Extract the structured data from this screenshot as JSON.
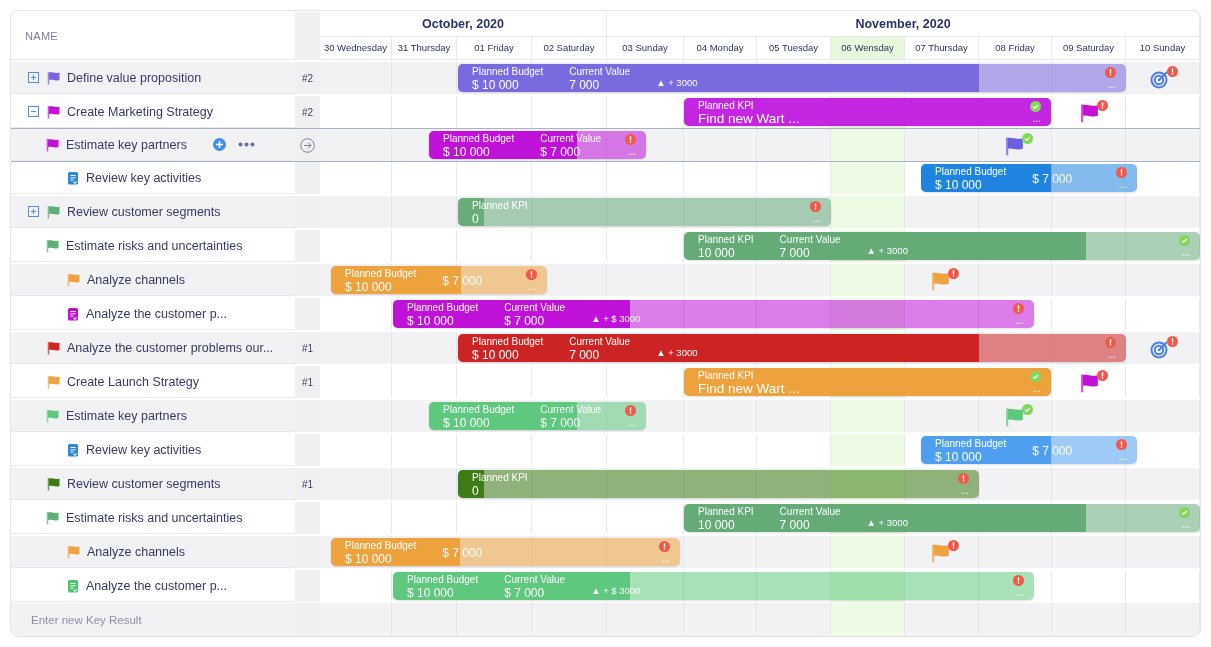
{
  "name_header": "NAME",
  "months": [
    {
      "label": "October, 2020"
    },
    {
      "label": "November, 2020"
    }
  ],
  "days": [
    {
      "label": "30 Wednesday",
      "selected": false
    },
    {
      "label": "31 Thursday",
      "selected": false
    },
    {
      "label": "01 Friday",
      "selected": false
    },
    {
      "label": "02 Saturday",
      "selected": false
    },
    {
      "label": "03 Sunday",
      "selected": false
    },
    {
      "label": "04 Monday",
      "selected": false
    },
    {
      "label": "05 Tuesday",
      "selected": false
    },
    {
      "label": "06 Wensday",
      "selected": true
    },
    {
      "label": "07 Thursday",
      "selected": false
    },
    {
      "label": "08 Friday",
      "selected": false
    },
    {
      "label": "09 Saturday",
      "selected": false
    },
    {
      "label": "10 Sunday",
      "selected": false
    }
  ],
  "rows": [
    {
      "title": "Define value proposition",
      "kind": "flag",
      "color": "#7a63e3",
      "expanded": false,
      "rank": "#2",
      "selected": false,
      "bar": {
        "color": "#7a6ae0",
        "level": 0.78,
        "fields": [
          {
            "label": "Planned Budget",
            "value": "$ 10 000"
          },
          {
            "label": "Current Value",
            "value": "7 000"
          }
        ],
        "delta": "▲ + 3000",
        "alert": true,
        "more": "..."
      },
      "marker": {
        "kind": "target",
        "alert": true
      }
    },
    {
      "title": "Create Marketing Strategy",
      "kind": "flag",
      "color": "#c30fd6",
      "expanded": true,
      "rank": "#2",
      "selected": false,
      "bar": {
        "color": "#c425e0",
        "level": 1,
        "fields": [
          {
            "label": "Planned KPI",
            "value": "Find new Wart ...",
            "large": true
          }
        ],
        "alert": false,
        "more": "..."
      },
      "marker": {
        "kind": "flag",
        "color": "#c30fd6",
        "alert": true
      },
      "children": [
        {
          "title": "Estimate key partners",
          "kind": "flag",
          "color": "#c30fd6",
          "selected": true,
          "bar": {
            "color": "#c011d8",
            "level": 0.68,
            "fields": [
              {
                "label": "Planned Budget",
                "value": "$ 10 000"
              },
              {
                "label": "Current Value",
                "value": "$ 7 000"
              }
            ],
            "alert": true,
            "more": "..."
          },
          "marker": {
            "kind": "flag",
            "color": "#6d5fe0",
            "alert": false
          },
          "children": [
            {
              "title": "Review key activities",
              "kind": "doc",
              "color": "#2f86e0",
              "selected": false,
              "bar": {
                "color": "#1e84e0",
                "level": 0.6,
                "fields": [
                  {
                    "label": "Planned Budget",
                    "value": "$ 10 000"
                  },
                  {
                    "value": "$ 7 000"
                  }
                ],
                "alert": true,
                "more": "..."
              }
            }
          ]
        }
      ]
    },
    {
      "title": "Review customer segments",
      "kind": "flag",
      "color": "#5fae78",
      "expanded": false,
      "selected": false,
      "bar": {
        "color": "#66ad7a",
        "level": 0.07,
        "fields": [
          {
            "label": "Planned KPI",
            "value": "0"
          }
        ],
        "alert": true,
        "more": "..."
      },
      "children": [
        {
          "title": "Estimate risks and uncertainties",
          "kind": "flag",
          "color": "#5fae78",
          "selected": false,
          "bar": {
            "color": "#64ab78",
            "level": 0.78,
            "fields": [
              {
                "label": "Planned KPI",
                "value": "10 000"
              },
              {
                "label": "Current Value",
                "value": "7 000"
              }
            ],
            "delta": "▲ + 3000",
            "alert": false,
            "more": "..."
          },
          "children": [
            {
              "title": "Analyze channels",
              "kind": "flag",
              "color": "#f0a23c",
              "selected": false,
              "bar": {
                "color": "#eea23e",
                "level": 0.6,
                "fields": [
                  {
                    "label": "Planned Budget",
                    "value": "$ 10 000"
                  },
                  {
                    "value": "$ 7 000"
                  }
                ],
                "alert": true,
                "more": "..."
              },
              "marker": {
                "kind": "flag",
                "color": "#f0a23c",
                "alert": true
              }
            },
            {
              "title": "Analyze the customer p...",
              "kind": "doc",
              "color": "#c30fd6",
              "selected": false,
              "bar": {
                "color": "#c011d8",
                "level": 0.37,
                "fields": [
                  {
                    "label": "Planned Budget",
                    "value": "$ 10 000"
                  },
                  {
                    "label": "Current Value",
                    "value": "$ 7 000"
                  }
                ],
                "delta": "▲ + $ 3000",
                "alert": true,
                "more": "..."
              }
            }
          ]
        }
      ]
    },
    {
      "title": "Analyze the customer problems our...",
      "kind": "flag",
      "color": "#d42424",
      "rank": "#1",
      "selected": false,
      "bar": {
        "color": "#cc2424",
        "level": 0.78,
        "fields": [
          {
            "label": "Planned Budget",
            "value": "$ 10 000"
          },
          {
            "label": "Current Value",
            "value": "7 000"
          }
        ],
        "delta": "▲ + 3000",
        "alert": true,
        "more": "..."
      },
      "marker": {
        "kind": "target",
        "alert": true
      }
    },
    {
      "title": "Create Launch Strategy",
      "kind": "flag",
      "color": "#f0a23c",
      "rank": "#1",
      "selected": false,
      "bar": {
        "color": "#eea23e",
        "level": 1,
        "fields": [
          {
            "label": "Planned KPI",
            "value": "Find new Wart ...",
            "large": true
          }
        ],
        "alert": false,
        "more": "..."
      },
      "marker": {
        "kind": "flag",
        "color": "#c30fd6",
        "alert": true
      },
      "children": [
        {
          "title": "Estimate key partners",
          "kind": "flag",
          "color": "#5ec87e",
          "selected": false,
          "bar": {
            "color": "#5ec87e",
            "level": 0.68,
            "fields": [
              {
                "label": "Planned Budget",
                "value": "$ 10 000"
              },
              {
                "label": "Current Value",
                "value": "$ 7 000"
              }
            ],
            "alert": true,
            "more": "..."
          },
          "marker": {
            "kind": "flag",
            "color": "#5ec87e",
            "alert": false
          },
          "children": [
            {
              "title": "Review key activities",
              "kind": "doc",
              "color": "#2f86e0",
              "selected": false,
              "bar": {
                "color": "#4f9ff0",
                "level": 0.6,
                "fields": [
                  {
                    "label": "Planned Budget",
                    "value": "$ 10 000"
                  },
                  {
                    "value": "$ 7 000"
                  }
                ],
                "alert": true,
                "more": "..."
              }
            }
          ]
        }
      ]
    },
    {
      "title": "Review customer segments",
      "kind": "flag",
      "color": "#3e7d16",
      "rank": "#1",
      "selected": false,
      "bar": {
        "color": "#3e7d16",
        "level": 0.05,
        "fields": [
          {
            "label": "Planned KPI",
            "value": "0"
          }
        ],
        "alert": true,
        "more": "..."
      },
      "children": [
        {
          "title": "Estimate risks and uncertainties",
          "kind": "flag",
          "color": "#5fae78",
          "selected": false,
          "bar": {
            "color": "#64ab78",
            "level": 0.78,
            "fields": [
              {
                "label": "Planned KPI",
                "value": "10 000"
              },
              {
                "label": "Current Value",
                "value": "7 000"
              }
            ],
            "delta": "▲ + 3000",
            "alert": false,
            "more": "..."
          },
          "children": [
            {
              "title": "Analyze channels",
              "kind": "flag",
              "color": "#f0a23c",
              "selected": false,
              "bar": {
                "color": "#eea23e",
                "level": 0.37,
                "fields": [
                  {
                    "label": "Planned Budget",
                    "value": "$ 10 000"
                  },
                  {
                    "value": "$ 7 000"
                  }
                ],
                "alert": true,
                "more": "..."
              },
              "marker": {
                "kind": "flag",
                "color": "#f0a23c",
                "alert": true
              }
            },
            {
              "title": "Analyze the customer p...",
              "kind": "doc",
              "color": "#4cc46e",
              "selected": false,
              "bar": {
                "color": "#5ec87e",
                "level": 0.37,
                "fields": [
                  {
                    "label": "Planned Budget",
                    "value": "$ 10 000"
                  },
                  {
                    "label": "Current Value",
                    "value": "$ 7 000"
                  }
                ],
                "delta": "▲ + $ 3000",
                "alert": true,
                "more": "..."
              }
            }
          ]
        }
      ]
    }
  ],
  "footer": {
    "placeholder": "Enter new Key Result"
  }
}
